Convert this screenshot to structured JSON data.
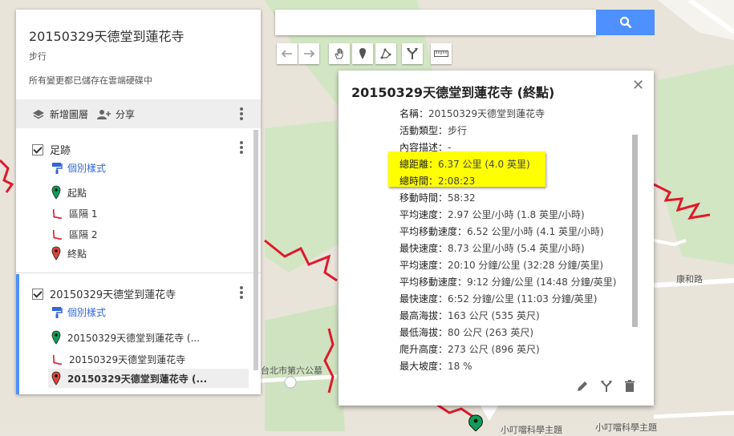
{
  "map": {
    "labels": [
      "康和路",
      "台北市第六公墓",
      "小叮噹科學主題",
      "小叮噹科學主題"
    ],
    "route_color": "#e0192a"
  },
  "panel": {
    "title": "20150329天德堂到蓮花寺",
    "subtitle": "步行",
    "saved_status": "所有變更都已儲存在雲端硬碟中",
    "add_layer": "新增圖層",
    "share": "分享",
    "layers": [
      {
        "name": "足跡",
        "style_link": "個別樣式",
        "items": [
          {
            "label": "起點",
            "icon": "green-pin-icon"
          },
          {
            "label": "區隔 1",
            "icon": "route-segment-icon"
          },
          {
            "label": "區隔 2",
            "icon": "route-segment-icon"
          },
          {
            "label": "終點",
            "icon": "red-pin-icon"
          }
        ]
      },
      {
        "name": "20150329天德堂到蓮花寺",
        "style_link": "個別樣式",
        "items": [
          {
            "label": "20150329天德堂到蓮花寺 (...",
            "icon": "green-pin-icon"
          },
          {
            "label": "20150329天德堂到蓮花寺",
            "icon": "route-segment-icon"
          },
          {
            "label": "20150329天德堂到蓮花寺 (...",
            "icon": "red-pin-icon"
          }
        ]
      }
    ]
  },
  "search": {
    "placeholder": ""
  },
  "popup": {
    "title": "20150329天德堂到蓮花寺 (終點)",
    "rows": [
      {
        "k": "名稱：",
        "v": "20150329天德堂到蓮花寺"
      },
      {
        "k": "活動類型：",
        "v": "步行"
      },
      {
        "k": "內容描述：",
        "v": "-"
      },
      {
        "k": "總距離：",
        "v": "6.37 公里 (4.0 英里)"
      },
      {
        "k": "總時間：",
        "v": "2:08:23"
      },
      {
        "k": "移動時間：",
        "v": "58:32"
      },
      {
        "k": "平均速度：",
        "v": "2.97 公里/小時 (1.8 英里/小時)"
      },
      {
        "k": "平均移動速度：",
        "v": "6.52 公里/小時 (4.1 英里/小時)"
      },
      {
        "k": "最快速度：",
        "v": "8.73 公里/小時 (5.4 英里/小時)"
      },
      {
        "k": "平均速度：",
        "v": "20:10 分鐘/公里 (32:28 分鐘/英里)"
      },
      {
        "k": "平均移動速度：",
        "v": "9:12 分鐘/公里 (14:48 分鐘/英里)"
      },
      {
        "k": "最快速度：",
        "v": "6:52 分鐘/公里 (11:03 分鐘/英里)"
      },
      {
        "k": "最高海拔：",
        "v": "163 公尺 (535 英尺)"
      },
      {
        "k": "最低海拔：",
        "v": "80 公尺 (263 英尺)"
      },
      {
        "k": "爬升高度：",
        "v": "273 公尺 (896 英尺)"
      },
      {
        "k": "最大坡度：",
        "v": "18 %"
      }
    ]
  },
  "colors": {
    "accent": "#4d90fe",
    "highlight": "#ffff00",
    "link": "#3367d6"
  }
}
